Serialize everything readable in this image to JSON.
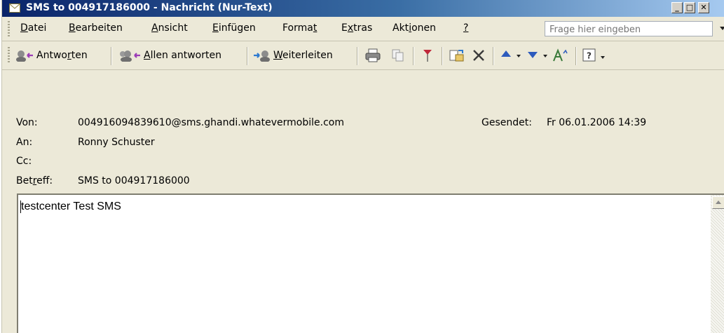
{
  "window": {
    "title": "SMS to 004917186000 - Nachricht (Nur-Text)",
    "minimize_glyph": "_",
    "maximize_glyph": "□",
    "close_glyph": "✕"
  },
  "menu": {
    "items": [
      {
        "label": "Datei",
        "accel": "D"
      },
      {
        "label": "Bearbeiten",
        "accel": "B"
      },
      {
        "label": "Ansicht",
        "accel": "A"
      },
      {
        "label": "Einfügen",
        "accel": "E"
      },
      {
        "label": "Format",
        "accel": "t"
      },
      {
        "label": "Extras",
        "accel": "x"
      },
      {
        "label": "Aktionen",
        "accel": "i"
      },
      {
        "label": "?",
        "accel": "?"
      }
    ],
    "help_placeholder": "Frage hier eingeben"
  },
  "toolbar": {
    "reply_label": "Antworten",
    "reply_all_label": "Allen antworten",
    "forward_label": "Weiterleiten",
    "icons": [
      "print-icon",
      "copy-icon",
      "flag-icon",
      "move-to-folder-icon",
      "delete-icon",
      "previous-item-icon",
      "next-item-icon",
      "font-size-icon",
      "help-icon"
    ]
  },
  "header": {
    "from_label": "Von:",
    "from_value": "004916094839610@sms.ghandi.whatevermobile.com",
    "sent_label": "Gesendet:",
    "sent_value": "Fr 06.01.2006 14:39",
    "to_label": "An:",
    "to_value": "Ronny Schuster",
    "cc_label": "Cc:",
    "cc_value": "",
    "subject_label": "Betreff:",
    "subject_value": "SMS to 004917186000"
  },
  "body": {
    "text": "testcenter Test SMS"
  },
  "colors": {
    "titlebar_start": "#0a246a",
    "titlebar_end": "#a6caf0",
    "chrome": "#ece9d8",
    "flag": "#c0283a",
    "arrow_blue": "#2d5bbd"
  }
}
